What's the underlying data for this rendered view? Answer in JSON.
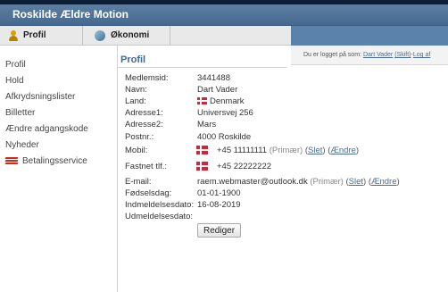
{
  "app": {
    "title": "Roskilde Ældre Motion"
  },
  "tabs": [
    {
      "label": "Profil",
      "icon": "person-icon"
    },
    {
      "label": "Økonomi",
      "icon": "globe-icon"
    }
  ],
  "infobar": {
    "prefix": "Du er logget på som:",
    "user": "Dart Vader",
    "shift": "(Skift)",
    "sep": " - ",
    "logout": "Log af"
  },
  "sidebar": {
    "items": [
      {
        "label": "Profil"
      },
      {
        "label": "Hold"
      },
      {
        "label": "Afkrydsningslister"
      },
      {
        "label": "Billetter"
      },
      {
        "label": "Ændre adgangskode"
      },
      {
        "label": "Nyheder"
      },
      {
        "label": "Betalingsservice",
        "icon": "betalingsservice-icon"
      }
    ]
  },
  "profile": {
    "title": "Profil",
    "rows": {
      "member_id": {
        "label": "Medlemsid:",
        "value": "3441488"
      },
      "name": {
        "label": "Navn:",
        "value": "Dart Vader"
      },
      "country": {
        "label": "Land:",
        "value": "Denmark"
      },
      "address1": {
        "label": "Adresse1:",
        "value": "Universvej 256"
      },
      "address2": {
        "label": "Adresse2:",
        "value": "Mars"
      },
      "postal": {
        "label": "Postnr.:",
        "value": "4000 Roskilde"
      },
      "mobile": {
        "label": "Mobil:",
        "value": "+45 11111111",
        "primary": "(Primær)",
        "delete": "Slet",
        "change": "Ændre"
      },
      "landline": {
        "label": "Fastnet tlf.:",
        "value": "+45 22222222"
      },
      "email": {
        "label": "E-mail:",
        "value": "raem.webmaster@outlook.dk",
        "primary": "(Primær)",
        "delete": "Slet",
        "change": "Ændre"
      },
      "birthday": {
        "label": "Fødselsdag:",
        "value": "01-01-1900"
      },
      "enrolled": {
        "label": "Indmeldelsesdato:",
        "value": "16-08-2019"
      },
      "unenrolled": {
        "label": "Udmeldelsesdato:",
        "value": ""
      }
    },
    "edit_button": "Rediger"
  },
  "colors": {
    "appbar": "#46698f",
    "topline": "#0c1e35",
    "link": "#4a6d94",
    "title": "#3f6a95",
    "flag_red": "#d0263b"
  }
}
